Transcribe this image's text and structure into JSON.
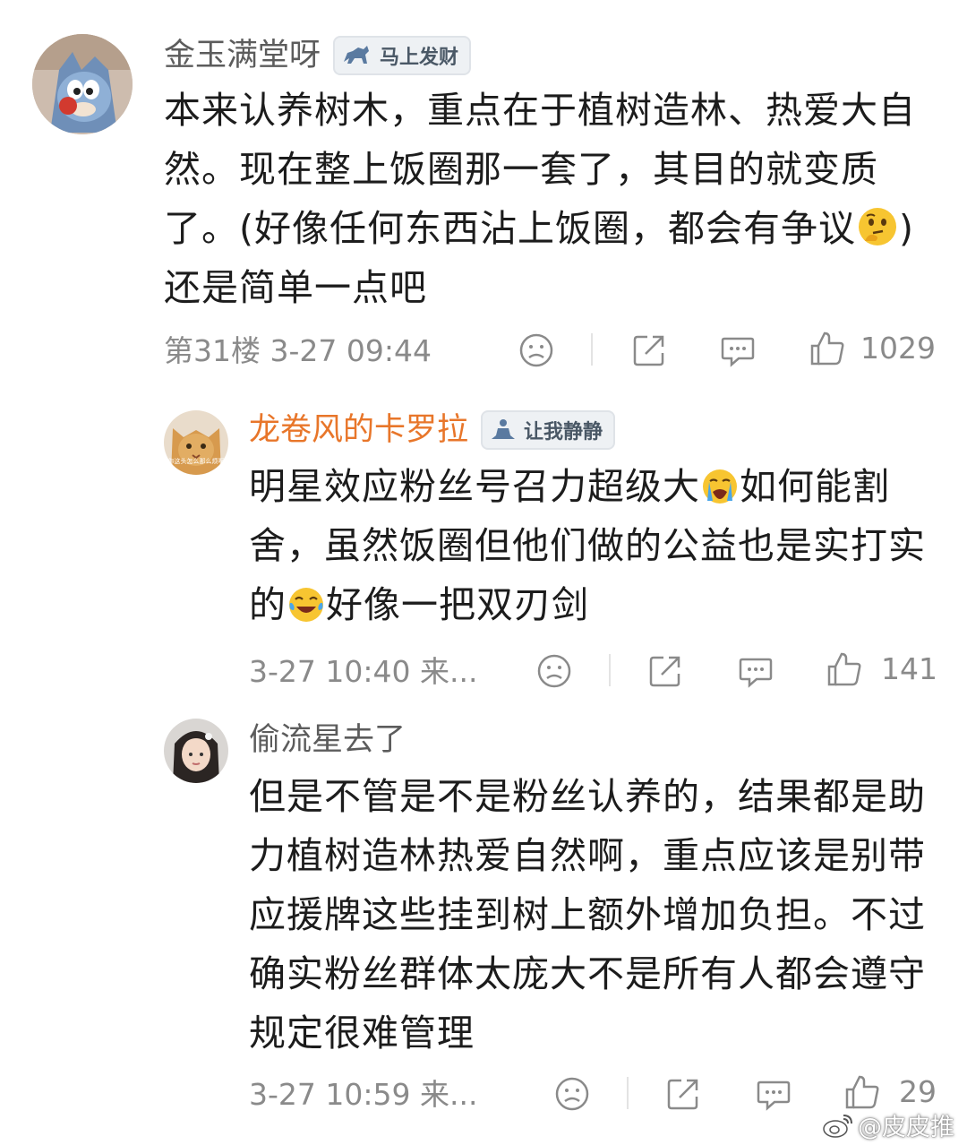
{
  "comments": [
    {
      "username": "金玉满堂呀",
      "badge": "马上发财",
      "text_before": "本来认养树木，重点在于植树造林、热爱大自然。现在整上饭圈那一套了，其目的就变质了。(好像任何东西沾上饭圈，都会有争议",
      "emoji": "thinking-face",
      "text_after": ") 还是简单一点吧",
      "meta": "第31楼 3-27 09:44",
      "likes": "1029"
    }
  ],
  "replies": [
    {
      "username": "龙卷风的卡罗拉",
      "username_color": "#e8762a",
      "badge": "让我静静",
      "avatar_caption": "你这头怎么那么烦啊",
      "text_1": "明星效应粉丝号召力超级大",
      "emoji_1": "crying-face",
      "text_2": "如何能割舍，虽然饭圈但他们做的公益也是实打实的",
      "emoji_2": "laughing-tears-face",
      "text_3": "好像一把双刃剑",
      "meta": "3-27 10:40 来...",
      "likes": "141"
    },
    {
      "username": "偷流星去了",
      "text": "但是不管是不是粉丝认养的，结果都是助力植树造林热爱自然啊，重点应该是别带应援牌这些挂到树上额外增加负担。不过确实粉丝群体太庞大不是所有人都会遵守规定很难管理",
      "meta": "3-27 10:59 来...",
      "likes": "29"
    }
  ],
  "watermark": "@皮皮推",
  "colors": {
    "accent_orange": "#e8762a",
    "meta_gray": "#8a8a8a",
    "badge_bg": "#eef1f4"
  },
  "icons": [
    "dislike-icon",
    "share-icon",
    "comment-icon",
    "like-icon",
    "weibo-logo-icon"
  ]
}
